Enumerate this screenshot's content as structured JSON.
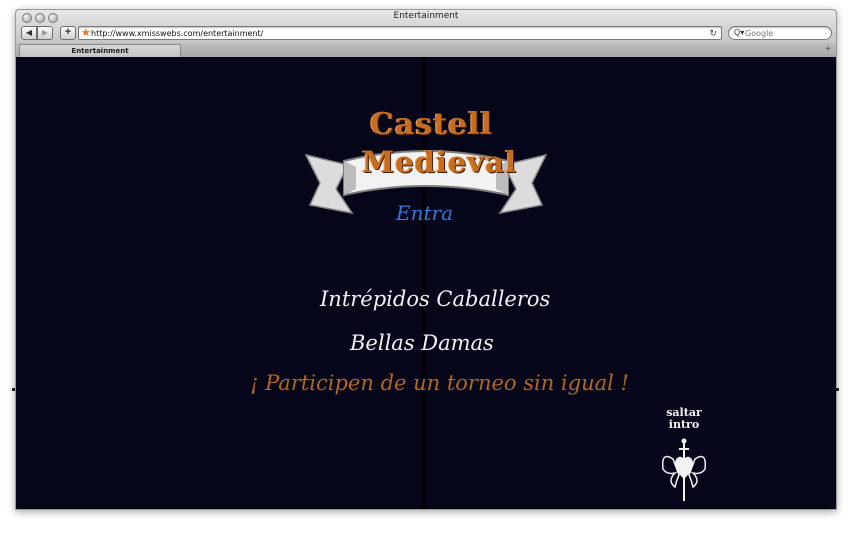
{
  "window": {
    "title": "Entertainment"
  },
  "toolbar": {
    "back_label": "◀",
    "forward_label": "▶",
    "add_label": "+",
    "url": "http://www.xmisswebs.com/entertainment/",
    "favicon": "★",
    "reload_label": "↻",
    "search_icon": "Q▾",
    "search_placeholder": "Google"
  },
  "tabs": [
    {
      "label": "Entertainment"
    }
  ],
  "newtab_label": "+",
  "page": {
    "logo_top": "Castell",
    "logo_bottom": "Medieval",
    "enter_label": "Entra",
    "line1": "Intrépidos Caballeros",
    "line2": "Bellas Damas",
    "line3": "¡ Participen de un torneo sin igual !",
    "skip_line1": "saltar",
    "skip_line2": "intro"
  },
  "colors": {
    "background": "#05061a",
    "logo_orange": "#c66d1f",
    "enter_blue": "#2f79e0",
    "text_white": "#f1f1f4",
    "text_orange": "#b5661e"
  },
  "icons": {
    "favicon": "star-icon",
    "reload": "reload-icon",
    "search": "magnifier-icon",
    "skip_emblem": "heart-sword-wings-icon",
    "logo_banner": "ribbon-banner-icon"
  }
}
